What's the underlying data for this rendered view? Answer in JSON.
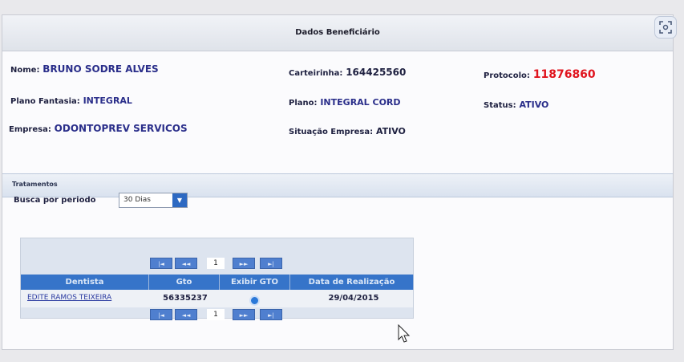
{
  "panel": {
    "title": "Dados Beneficiário"
  },
  "beneficiary": {
    "nome_label": "Nome:",
    "nome_value": "BRUNO SODRE ALVES",
    "carteirinha_label": "Carteirinha:",
    "carteirinha_value": "164425560",
    "protocolo_label": "Protocolo:",
    "protocolo_value": "11876860",
    "plano_fantasia_label": "Plano Fantasia:",
    "plano_fantasia_value": "INTEGRAL",
    "plano_label": "Plano:",
    "plano_value": "INTEGRAL CORD",
    "status_label": "Status:",
    "status_value": "ATIVO",
    "empresa_label": "Empresa:",
    "empresa_value": "ODONTOPREV SERVICOS",
    "situacao_label": "Situação Empresa:",
    "situacao_value": "ATIVO"
  },
  "tratamentos": {
    "title": "Tratamentos",
    "busca_label": "Busca por periodo",
    "periodo_selected": "30 Dias"
  },
  "grid": {
    "columns": [
      "Dentista",
      "Gto",
      "Exibir GTO",
      "Data de Realização"
    ],
    "rows": [
      {
        "dentista": "EDITE RAMOS TEIXEIRA",
        "gto": "56335237",
        "data": "29/04/2015"
      }
    ],
    "page": "1"
  },
  "icons": {
    "pager_first": "first-page-icon",
    "pager_prev": "prev-page-icon",
    "pager_next": "next-page-icon",
    "pager_last": "last-page-icon",
    "view": "view-gto-icon",
    "scan": "scan-icon",
    "cursor": "mouse-cursor-icon"
  },
  "colors": {
    "accent": "#3674c9",
    "protocol": "#e0141e",
    "value": "#2a2e8a"
  }
}
